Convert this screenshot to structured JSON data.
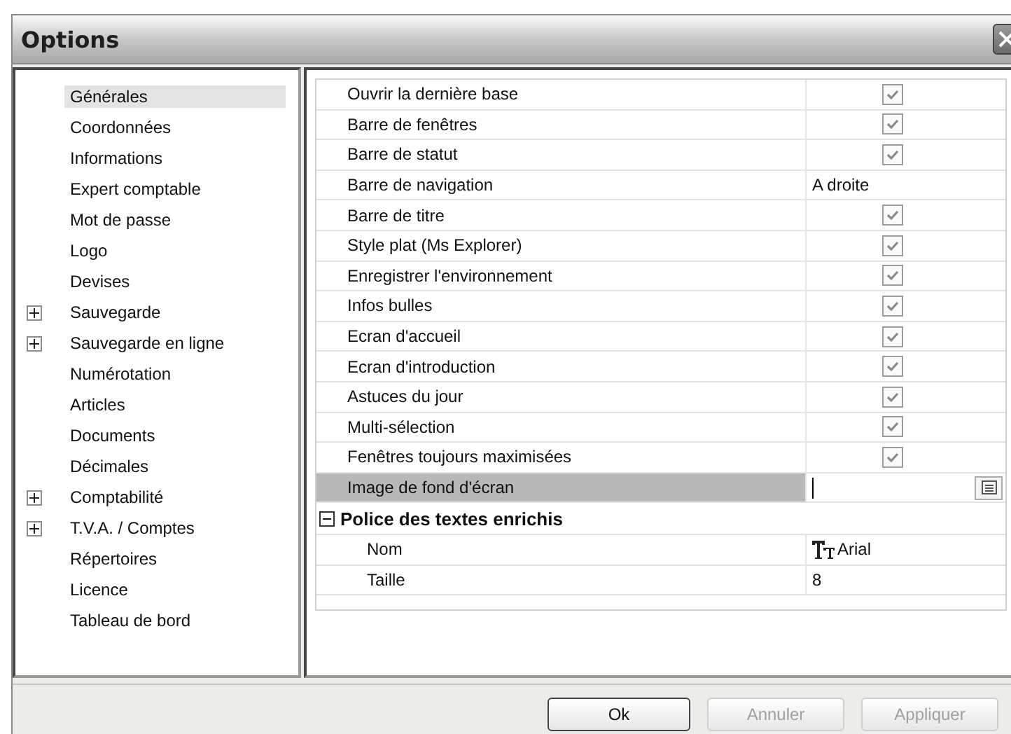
{
  "window": {
    "title": "Options"
  },
  "sidebar": {
    "items": [
      {
        "label": "Générales",
        "selected": true
      },
      {
        "label": "Coordonnées",
        "selected": false
      },
      {
        "label": "Informations",
        "selected": false
      },
      {
        "label": "Expert comptable",
        "selected": false
      },
      {
        "label": "Mot de passe",
        "selected": false
      },
      {
        "label": "Logo",
        "selected": false
      },
      {
        "label": "Devises",
        "selected": false
      },
      {
        "label": "Sauvegarde",
        "selected": false,
        "expanded": false
      },
      {
        "label": "Sauvegarde en ligne",
        "selected": false,
        "expanded": false
      },
      {
        "label": "Numérotation",
        "selected": false
      },
      {
        "label": "Articles",
        "selected": false
      },
      {
        "label": "Documents",
        "selected": false
      },
      {
        "label": "Décimales",
        "selected": false
      },
      {
        "label": "Comptabilité",
        "selected": false,
        "expanded": false
      },
      {
        "label": "T.V.A. / Comptes",
        "selected": false,
        "expanded": false
      },
      {
        "label": "Répertoires",
        "selected": false
      },
      {
        "label": "Licence",
        "selected": false
      },
      {
        "label": "Tableau de bord",
        "selected": false
      }
    ]
  },
  "properties": {
    "rows": [
      {
        "kind": "checkbox",
        "label": "Ouvrir la dernière base",
        "checked": true,
        "selected": false
      },
      {
        "kind": "checkbox",
        "label": "Barre de fenêtres",
        "checked": true,
        "selected": false
      },
      {
        "kind": "checkbox",
        "label": "Barre de statut",
        "checked": true,
        "selected": false
      },
      {
        "kind": "text",
        "label": "Barre de navigation",
        "value": "A droite",
        "selected": false
      },
      {
        "kind": "checkbox",
        "label": "Barre de titre",
        "checked": true,
        "selected": false
      },
      {
        "kind": "checkbox",
        "label": "Style plat (Ms Explorer)",
        "checked": true,
        "selected": false
      },
      {
        "kind": "checkbox",
        "label": "Enregistrer l'environnement",
        "checked": true,
        "selected": false
      },
      {
        "kind": "checkbox",
        "label": "Infos bulles",
        "checked": true,
        "selected": false
      },
      {
        "kind": "checkbox",
        "label": "Ecran d'accueil",
        "checked": true,
        "selected": false
      },
      {
        "kind": "checkbox",
        "label": "Ecran d'introduction",
        "checked": true,
        "selected": false
      },
      {
        "kind": "checkbox",
        "label": "Astuces du jour",
        "checked": true,
        "selected": false
      },
      {
        "kind": "checkbox",
        "label": "Multi-sélection",
        "checked": true,
        "selected": false
      },
      {
        "kind": "checkbox",
        "label": "Fenêtres toujours maximisées",
        "checked": true,
        "selected": false
      },
      {
        "kind": "file",
        "label": "Image de fond d'écran",
        "selected": true
      }
    ],
    "category": {
      "label": "Police des textes enrichis",
      "expanded": true,
      "children": [
        {
          "kind": "font",
          "label": "Nom",
          "value": "Arial",
          "selected": false
        },
        {
          "kind": "text",
          "label": "Taille",
          "value": "8",
          "selected": false
        }
      ]
    }
  },
  "buttons": [
    {
      "label": "Ok",
      "disabled": false
    },
    {
      "label": "Annuler",
      "disabled": true
    },
    {
      "label": "Appliquer",
      "disabled": true
    }
  ]
}
